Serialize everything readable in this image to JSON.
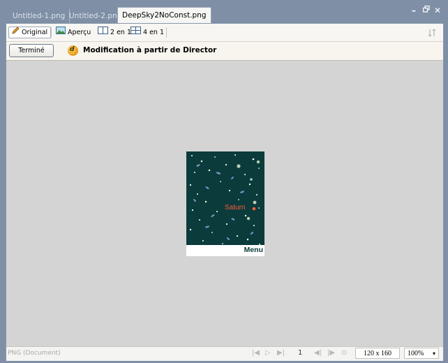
{
  "tabs": [
    {
      "label": "Untitled-1.png",
      "active": false
    },
    {
      "label": "Untitled-2.png",
      "active": false
    },
    {
      "label": "DeepSky2NoConst.png",
      "active": true
    }
  ],
  "window_controls": {
    "minimize": "–",
    "restore": "▫",
    "close": "✕"
  },
  "toolbar": {
    "original": "Original",
    "preview": "Aperçu",
    "two_up": "2 en 1",
    "four_up": "4 en 1"
  },
  "notice": {
    "done_button": "Terminé",
    "message": "Modification à partir de Director",
    "icon": "dw"
  },
  "image": {
    "label": "Saturn",
    "menu": "Menu"
  },
  "status": {
    "document_type": "PNG (Document)",
    "frame_number": "1",
    "dimensions": "120 x 160",
    "zoom": "100%"
  }
}
